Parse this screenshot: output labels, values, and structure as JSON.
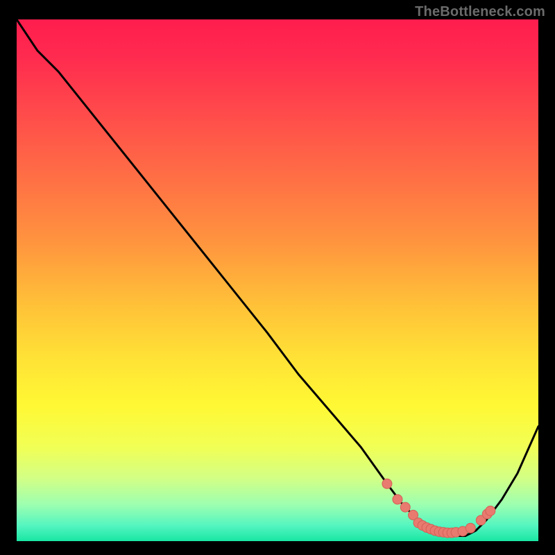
{
  "attribution": "TheBottleneck.com",
  "colors": {
    "frame": "#000000",
    "attribution_text": "#6b6b6b",
    "curve_stroke": "#000000",
    "marker_fill": "#e87a6f",
    "marker_stroke": "#d46056",
    "gradient_stops": [
      {
        "offset": 0,
        "color": "#ff1d4e"
      },
      {
        "offset": 0.07,
        "color": "#ff2a4f"
      },
      {
        "offset": 0.18,
        "color": "#ff4b4b"
      },
      {
        "offset": 0.3,
        "color": "#ff6e45"
      },
      {
        "offset": 0.42,
        "color": "#ff923f"
      },
      {
        "offset": 0.55,
        "color": "#ffc238"
      },
      {
        "offset": 0.65,
        "color": "#ffe236"
      },
      {
        "offset": 0.74,
        "color": "#fff834"
      },
      {
        "offset": 0.82,
        "color": "#f1ff55"
      },
      {
        "offset": 0.88,
        "color": "#d2ff86"
      },
      {
        "offset": 0.93,
        "color": "#9dffb0"
      },
      {
        "offset": 0.97,
        "color": "#55f5c0"
      },
      {
        "offset": 1.0,
        "color": "#19e7a3"
      }
    ]
  },
  "chart_data": {
    "type": "line",
    "title": "",
    "xlabel": "",
    "ylabel": "",
    "xlim": [
      0,
      100
    ],
    "ylim": [
      0,
      100
    ],
    "grid": false,
    "legend": false,
    "series": [
      {
        "name": "bottleneck-curve",
        "x": [
          0,
          4,
          8,
          16,
          24,
          32,
          40,
          48,
          54,
          60,
          66,
          71,
          74,
          77,
          80,
          83,
          86,
          88,
          90,
          93,
          96,
          100
        ],
        "y": [
          100,
          94,
          90,
          80,
          70,
          60,
          50,
          40,
          32,
          25,
          18,
          11,
          7,
          4,
          2,
          1,
          1,
          2,
          4,
          8,
          13,
          22
        ]
      }
    ],
    "markers": {
      "name": "marker-dots",
      "x": [
        71.0,
        73.0,
        74.5,
        76.0,
        77.0,
        77.8,
        78.6,
        79.4,
        80.2,
        81.0,
        81.8,
        82.6,
        83.4,
        84.2,
        85.5,
        87.0,
        89.0,
        90.2,
        90.8
      ],
      "y": [
        11.0,
        8.0,
        6.5,
        5.0,
        3.5,
        3.0,
        2.6,
        2.3,
        2.0,
        1.8,
        1.7,
        1.6,
        1.6,
        1.7,
        1.9,
        2.5,
        4.0,
        5.2,
        5.8
      ]
    }
  }
}
